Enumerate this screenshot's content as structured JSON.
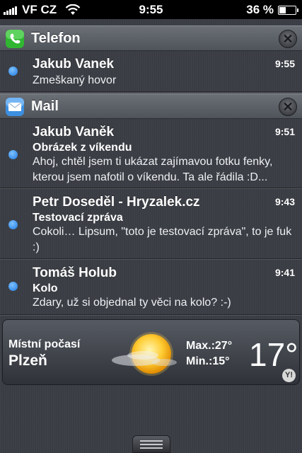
{
  "status_bar": {
    "carrier": "VF CZ",
    "time": "9:55",
    "battery": "36 %",
    "battery_level": 0.36
  },
  "sections": {
    "phone": {
      "title": "Telefon",
      "icon": "phone-icon",
      "items": [
        {
          "sender": "Jakub Vanek",
          "time": "9:55",
          "body": "Zmeškaný hovor"
        }
      ]
    },
    "mail": {
      "title": "Mail",
      "icon": "mail-icon",
      "items": [
        {
          "sender": "Jakub Vaněk",
          "time": "9:51",
          "subject": "Obrázek z víkendu",
          "body": "Ahoj, chtěl jsem ti ukázat zajímavou fotku fenky, kterou jsem nafotil o víkendu. Ta ale řádila :D..."
        },
        {
          "sender": "Petr Doseděl - Hryzalek.cz",
          "time": "9:43",
          "subject": "Testovací zpráva",
          "body": "Cokoli… Lipsum, \"toto je testovací zpráva\", to je fuk :)"
        },
        {
          "sender": "Tomáš Holub",
          "time": "9:41",
          "subject": "Kolo",
          "body": "Zdary, už si objednal ty věci na kolo? :-)"
        }
      ]
    }
  },
  "weather": {
    "label": "Místní počasí",
    "city": "Plzeň",
    "max": "Max.:27°",
    "min": "Min.:15°",
    "temp": "17°",
    "badge": "Y!",
    "icon": "sun-with-clouds-icon"
  },
  "colors": {
    "unread_dot": "#1f7ae0",
    "phone_icon": "#2eb82e",
    "mail_icon": "#3b8fe0"
  }
}
